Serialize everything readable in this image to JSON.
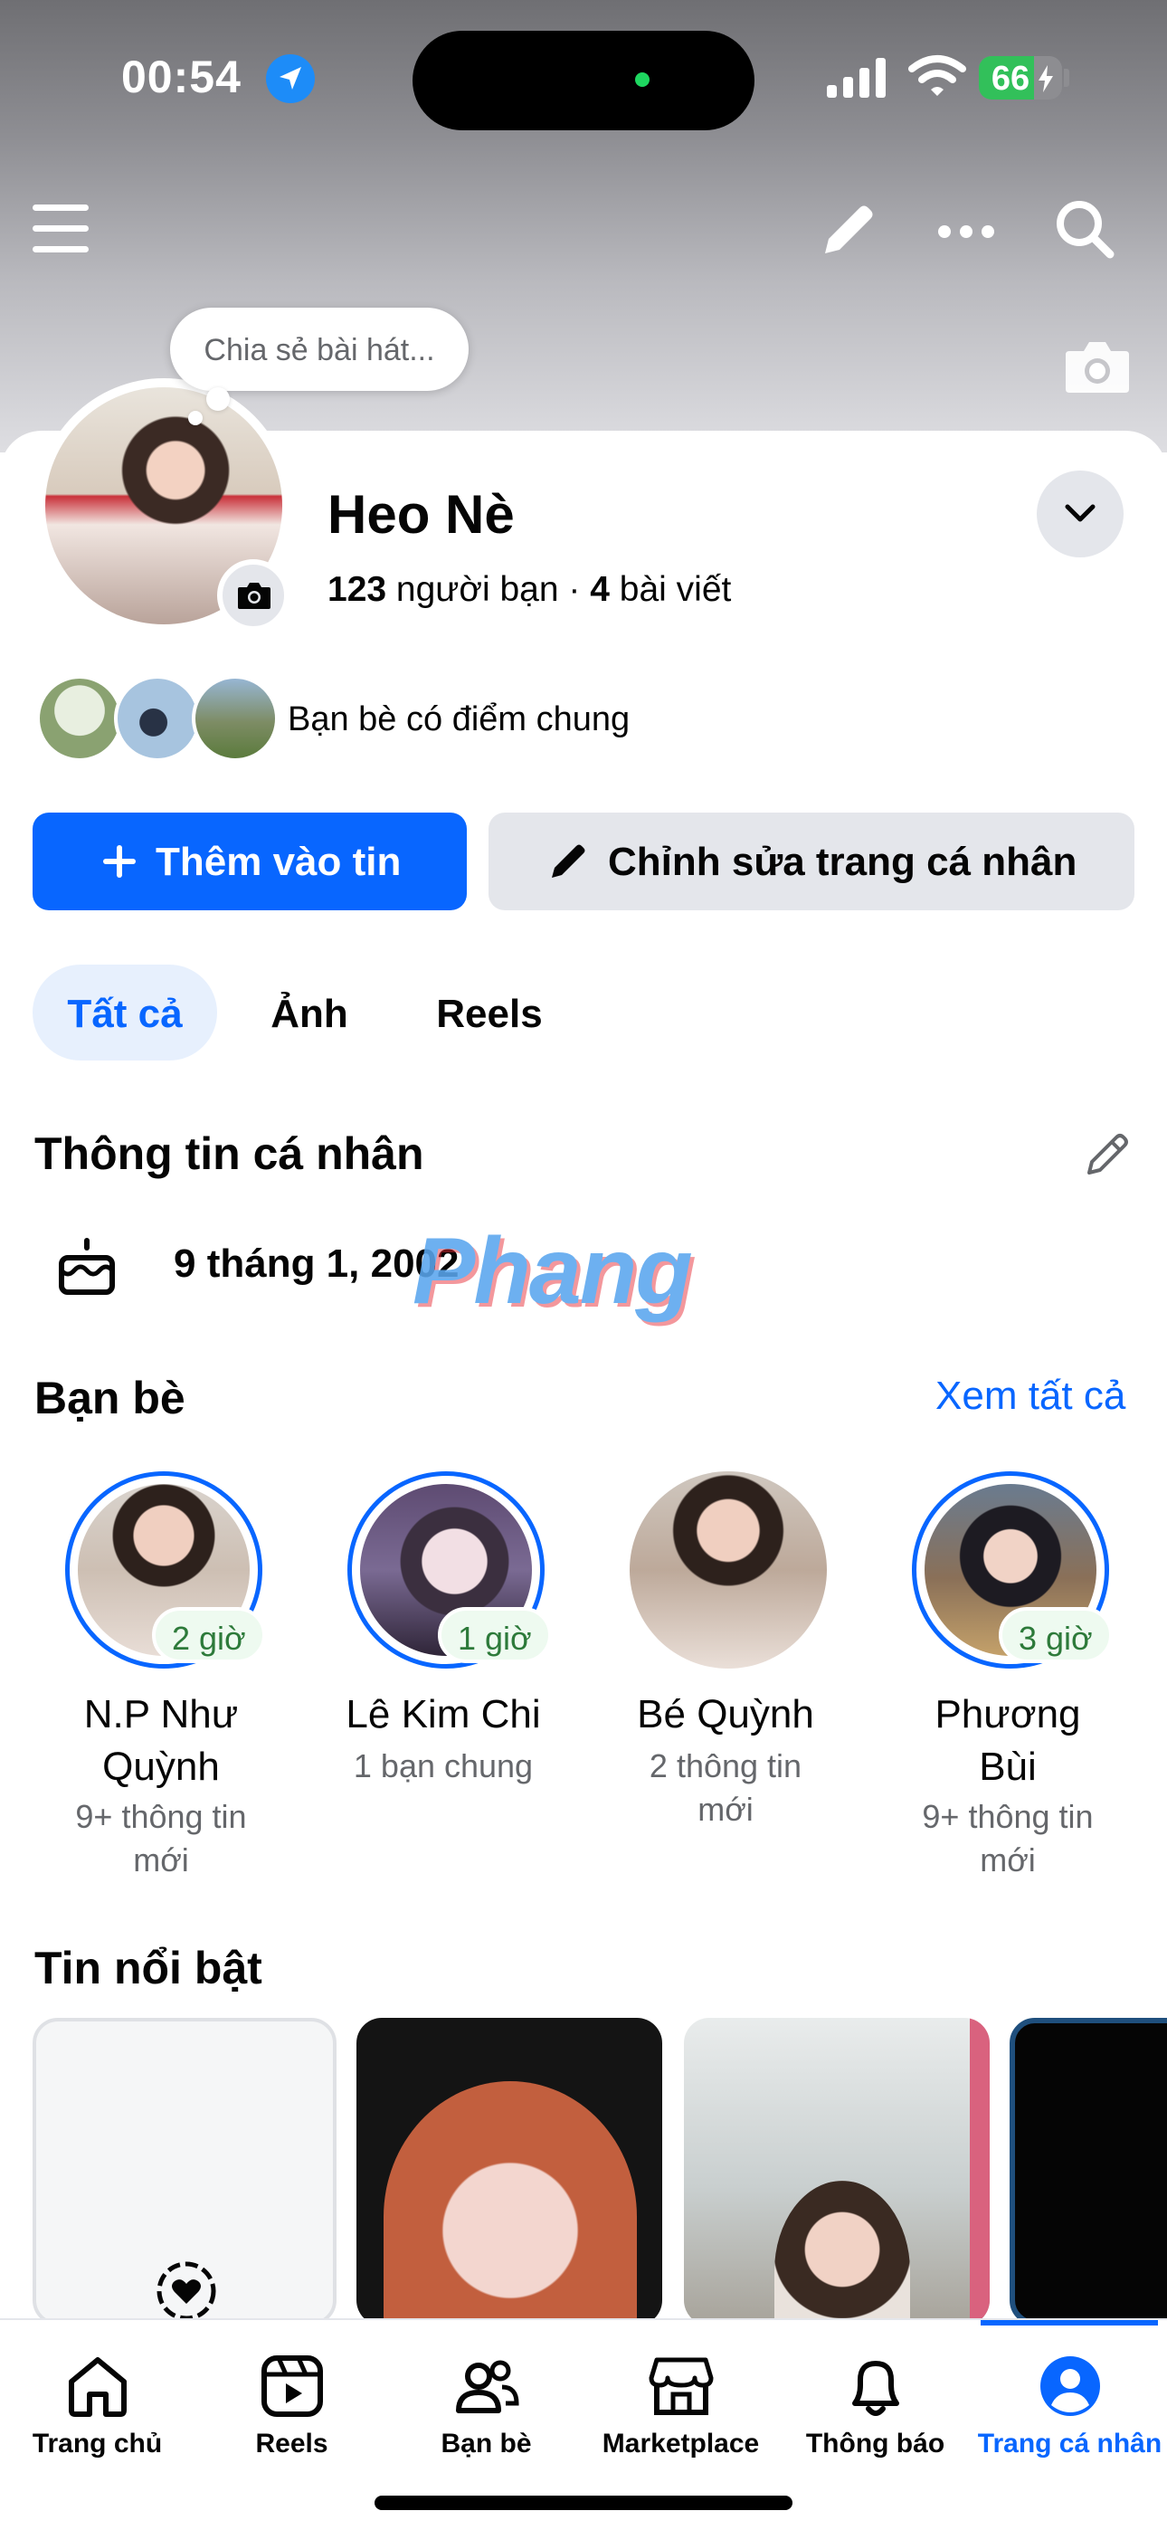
{
  "status_bar": {
    "time": "00:54",
    "battery": "66",
    "battery_level": 0.66
  },
  "header_actions": [
    "menu-icon",
    "pencil-icon",
    "more-icon",
    "search-icon",
    "camera-icon"
  ],
  "profile": {
    "song_prompt": "Chia sẻ bài hát...",
    "name": "Heo Nè",
    "friends_count": "123",
    "friends_label": "người bạn",
    "separator": "·",
    "posts_count": "4",
    "posts_label": "bài viết",
    "mutual_text": "Bạn bè có điểm chung"
  },
  "actions": {
    "add_story": "Thêm vào tin",
    "edit_profile": "Chỉnh sửa trang cá nhân"
  },
  "tabs": [
    {
      "label": "Tất cả",
      "active": true
    },
    {
      "label": "Ảnh",
      "active": false
    },
    {
      "label": "Reels",
      "active": false
    }
  ],
  "about": {
    "title": "Thông tin cá nhân",
    "birthday": "9 tháng 1, 2002"
  },
  "watermark": "Phang",
  "friends_section": {
    "title": "Bạn bè",
    "see_all": "Xem tất cả",
    "items": [
      {
        "name_line1": "N.P Như",
        "name_line2": "Quỳnh",
        "badge": "2 giờ",
        "sub_line1": "9+ thông tin",
        "sub_line2": "mới"
      },
      {
        "name_line1": "Lê Kim Chi",
        "name_line2": "",
        "badge": "1 giờ",
        "sub_line1": "1 bạn chung",
        "sub_line2": ""
      },
      {
        "name_line1": "Bé Quỳnh",
        "name_line2": "",
        "badge": "",
        "sub_line1": "2 thông tin",
        "sub_line2": "mới"
      },
      {
        "name_line1": "Phương",
        "name_line2": "Bùi",
        "badge": "3 giờ",
        "sub_line1": "9+ thông tin",
        "sub_line2": "mới"
      }
    ]
  },
  "highlights": {
    "title": "Tin nổi bật"
  },
  "bottom_nav": [
    {
      "label": "Trang chủ",
      "icon": "home-icon"
    },
    {
      "label": "Reels",
      "icon": "reels-icon"
    },
    {
      "label": "Bạn bè",
      "icon": "friends-icon"
    },
    {
      "label": "Marketplace",
      "icon": "marketplace-icon"
    },
    {
      "label": "Thông báo",
      "icon": "bell-icon"
    },
    {
      "label": "Trang cá nhân",
      "icon": "profile-icon",
      "active": true
    }
  ],
  "colors": {
    "accent": "#0866ff",
    "secondary_button": "#e4e6eb",
    "badge_text": "#2d7a3a"
  }
}
